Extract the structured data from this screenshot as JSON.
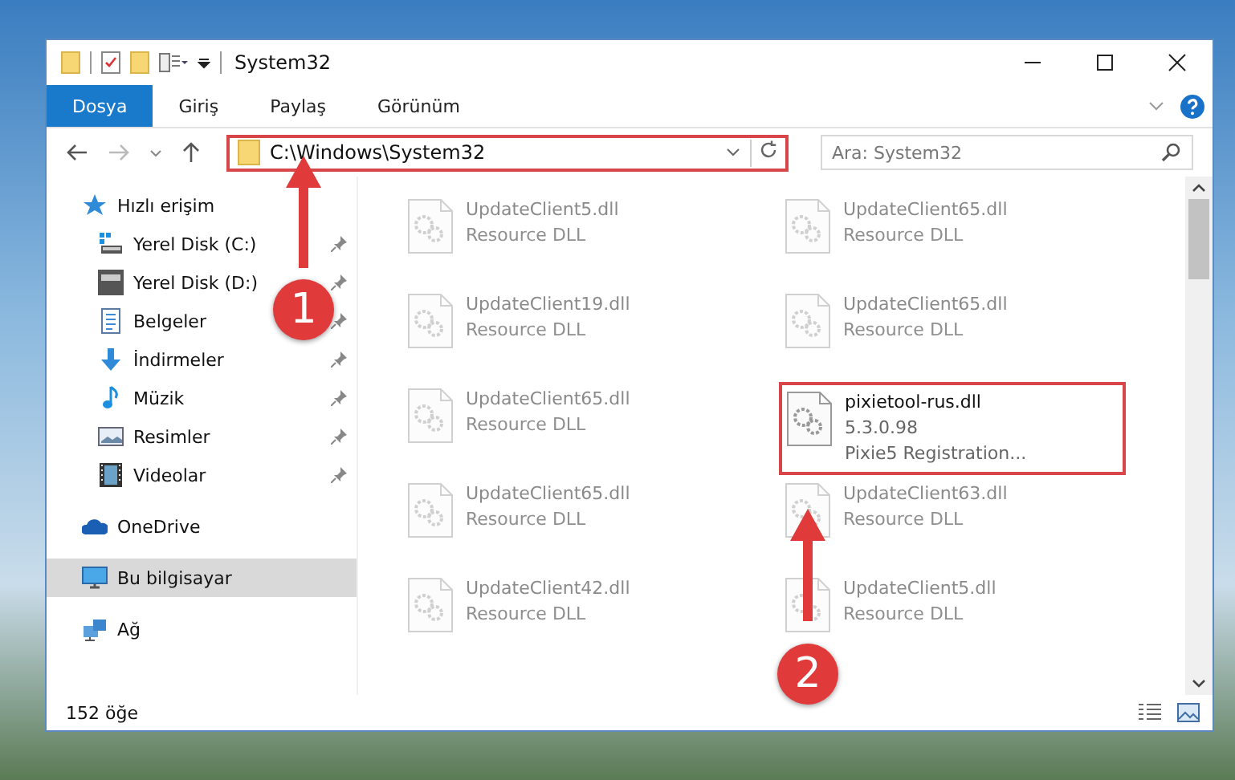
{
  "window": {
    "title": "System32"
  },
  "ribbon_tabs": [
    {
      "label": "Dosya",
      "selected": true
    },
    {
      "label": "Giriş",
      "selected": false
    },
    {
      "label": "Paylaş",
      "selected": false
    },
    {
      "label": "Görünüm",
      "selected": false
    }
  ],
  "address": {
    "path": "C:\\Windows\\System32",
    "highlighted": true
  },
  "search": {
    "placeholder": "Ara: System32"
  },
  "sidebar": {
    "items": [
      {
        "label": "Hızlı erişim",
        "kind": "star",
        "selected": false,
        "children": [
          {
            "label": "Yerel Disk (C:)",
            "kind": "system-drive",
            "pinned": true
          },
          {
            "label": "Yerel Disk (D:)",
            "kind": "drive",
            "pinned": true
          },
          {
            "label": "Belgeler",
            "kind": "document",
            "pinned": true
          },
          {
            "label": "İndirmeler",
            "kind": "download",
            "pinned": true
          },
          {
            "label": "Müzik",
            "kind": "music",
            "pinned": true
          },
          {
            "label": "Resimler",
            "kind": "pictures",
            "pinned": true
          },
          {
            "label": "Videolar",
            "kind": "videos",
            "pinned": true
          }
        ]
      },
      {
        "label": "OneDrive",
        "kind": "cloud",
        "selected": false
      },
      {
        "label": "Bu bilgisayar",
        "kind": "computer",
        "selected": true
      },
      {
        "label": "Ağ",
        "kind": "network",
        "selected": false
      }
    ]
  },
  "files": [
    {
      "name": "UpdateClient5.dll",
      "details": [
        "Resource DLL"
      ],
      "highlighted": false
    },
    {
      "name": "UpdateClient65.dll",
      "details": [
        "Resource DLL"
      ],
      "highlighted": false
    },
    {
      "name": "UpdateClient19.dll",
      "details": [
        "Resource DLL"
      ],
      "highlighted": false
    },
    {
      "name": "UpdateClient65.dll",
      "details": [
        "Resource DLL"
      ],
      "highlighted": false
    },
    {
      "name": "UpdateClient65.dll",
      "details": [
        "Resource DLL"
      ],
      "highlighted": false
    },
    {
      "name": "pixietool-rus.dll",
      "details": [
        "5.3.0.98",
        "Pixie5 Registration..."
      ],
      "highlighted": true
    },
    {
      "name": "UpdateClient65.dll",
      "details": [
        "Resource DLL"
      ],
      "highlighted": false
    },
    {
      "name": "UpdateClient63.dll",
      "details": [
        "Resource DLL"
      ],
      "highlighted": false
    },
    {
      "name": "UpdateClient42.dll",
      "details": [
        "Resource DLL"
      ],
      "highlighted": false
    },
    {
      "name": "UpdateClient5.dll",
      "details": [
        "Resource DLL"
      ],
      "highlighted": false
    }
  ],
  "status_bar": {
    "item_count": "152 öğe"
  },
  "callouts": [
    {
      "number": "1"
    },
    {
      "number": "2"
    }
  ]
}
